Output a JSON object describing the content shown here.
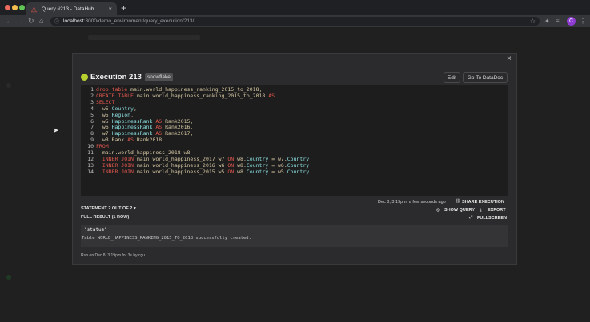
{
  "browser": {
    "tab_title": "Query #213 - DataHub",
    "tab_close": "×",
    "new_tab": "+",
    "url_host": "localhost",
    "url_path": ":3000/demo_environment/query_execution/213/",
    "avatar_initial": "C",
    "traffic_colors": [
      "#ed6a5e",
      "#f5bf4f",
      "#62c554"
    ]
  },
  "modal": {
    "close": "×",
    "execution_title": "Execution 213",
    "engine": "snowflake",
    "edit_label": "Edit",
    "datadoc_label": "Go To DataDoc",
    "status_color": "#b8d12e"
  },
  "code_lines": [
    [
      {
        "t": "drop table ",
        "c": "kw"
      },
      {
        "t": "main.world_happiness_ranking_2015_to_2018;",
        "c": "id"
      }
    ],
    [
      {
        "t": "CREATE TABLE ",
        "c": "kw"
      },
      {
        "t": "main.world_happiness_ranking_2015_to_2018 ",
        "c": "id"
      },
      {
        "t": "AS",
        "c": "kw"
      }
    ],
    [
      {
        "t": "SELECT",
        "c": "kw"
      }
    ],
    [
      {
        "t": "  w5.",
        "c": "id"
      },
      {
        "t": "Country",
        "c": "fld"
      },
      {
        "t": ",",
        "c": "id"
      }
    ],
    [
      {
        "t": "  w5.",
        "c": "id"
      },
      {
        "t": "Region",
        "c": "fld"
      },
      {
        "t": ",",
        "c": "id"
      }
    ],
    [
      {
        "t": "  w5.",
        "c": "id"
      },
      {
        "t": "HappinessRank ",
        "c": "fld"
      },
      {
        "t": "AS ",
        "c": "kw"
      },
      {
        "t": "Rank2015,",
        "c": "id"
      }
    ],
    [
      {
        "t": "  w6.",
        "c": "id"
      },
      {
        "t": "HappinessRank ",
        "c": "fld"
      },
      {
        "t": "AS ",
        "c": "kw"
      },
      {
        "t": "Rank2016,",
        "c": "id"
      }
    ],
    [
      {
        "t": "  w7.",
        "c": "id"
      },
      {
        "t": "HappinessRank ",
        "c": "fld"
      },
      {
        "t": "AS ",
        "c": "kw"
      },
      {
        "t": "Rank2017,",
        "c": "id"
      }
    ],
    [
      {
        "t": "  w8.Rank ",
        "c": "id"
      },
      {
        "t": "AS ",
        "c": "kw"
      },
      {
        "t": "Rank2018",
        "c": "id"
      }
    ],
    [
      {
        "t": "FROM",
        "c": "kw"
      }
    ],
    [
      {
        "t": "  main.world_happiness_2018 w8",
        "c": "id"
      }
    ],
    [
      {
        "t": "  INNER JOIN ",
        "c": "kw"
      },
      {
        "t": "main.world_happiness_2017 w7 ",
        "c": "id"
      },
      {
        "t": "ON ",
        "c": "kw"
      },
      {
        "t": "w8.",
        "c": "id"
      },
      {
        "t": "Country ",
        "c": "fld"
      },
      {
        "t": "= w7.",
        "c": "id"
      },
      {
        "t": "Country",
        "c": "fld"
      }
    ],
    [
      {
        "t": "  INNER JOIN ",
        "c": "kw"
      },
      {
        "t": "main.world_happiness_2016 w6 ",
        "c": "id"
      },
      {
        "t": "ON ",
        "c": "kw"
      },
      {
        "t": "w8.",
        "c": "id"
      },
      {
        "t": "Country ",
        "c": "fld"
      },
      {
        "t": "= w6.",
        "c": "id"
      },
      {
        "t": "Country",
        "c": "fld"
      }
    ],
    [
      {
        "t": "  INNER JOIN ",
        "c": "kw"
      },
      {
        "t": "main.world_happiness_2015 w5 ",
        "c": "id"
      },
      {
        "t": "ON ",
        "c": "kw"
      },
      {
        "t": "w8.",
        "c": "id"
      },
      {
        "t": "Country ",
        "c": "fld"
      },
      {
        "t": "= w5.",
        "c": "id"
      },
      {
        "t": "Country",
        "c": "fld"
      }
    ]
  ],
  "execution_meta": {
    "timestamp": "Dec 8, 3:19pm, a few seconds ago",
    "share_label": "SHARE EXECUTION"
  },
  "statement": {
    "label": "STATEMENT 2 OUT OF 2",
    "full_result": "FULL RESULT (1 ROW)",
    "show_query": "SHOW QUERY",
    "export": "EXPORT",
    "fullscreen": "FULLSCREEN"
  },
  "result": {
    "header": "\"status\"",
    "row": "Table WORLD_HAPPINESS_RANKING_2015_TO_2018 successfully created."
  },
  "run_info": "Run on Dec 8, 3:19pm for 3s by cgu."
}
